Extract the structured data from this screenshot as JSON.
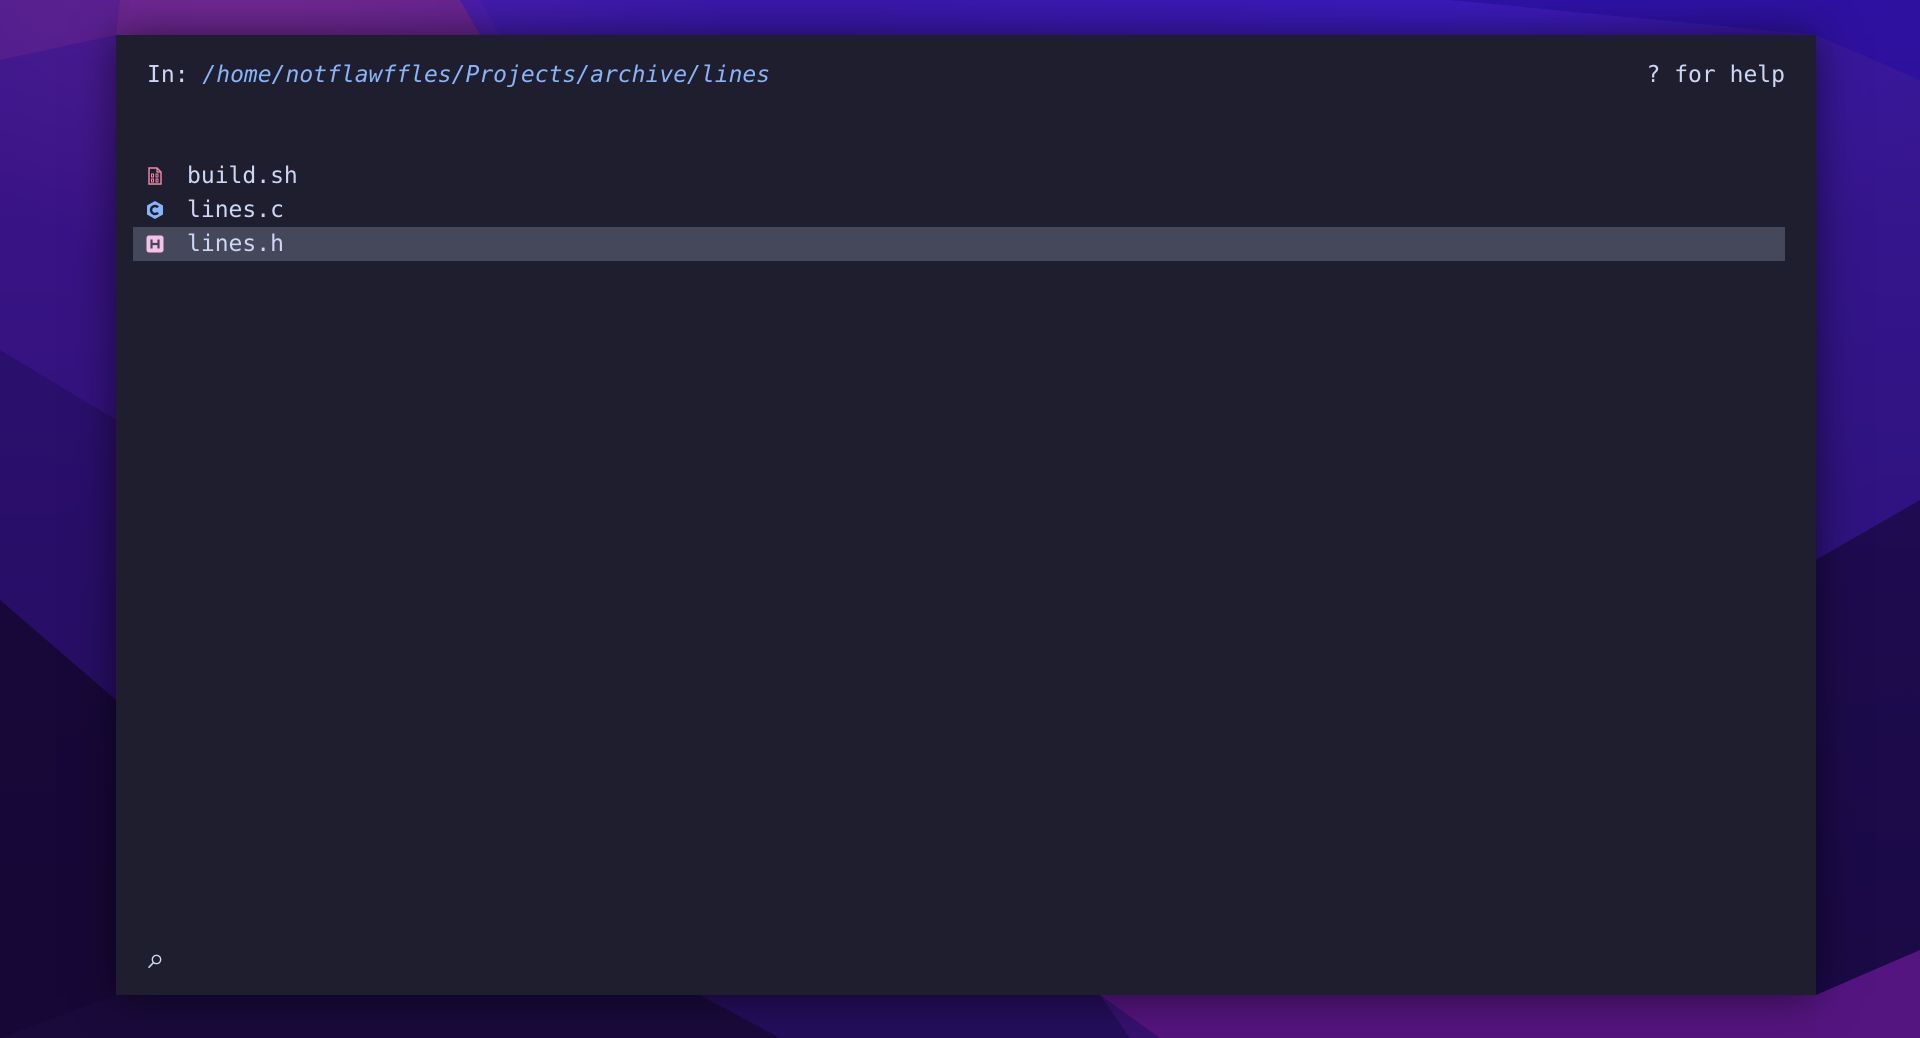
{
  "header": {
    "prefix": "In: ",
    "path": "/home/notflawffles/Projects/archive/lines",
    "help": "? for help"
  },
  "files": [
    {
      "name": "build.sh",
      "icon": "shell-script-icon",
      "color": "#f38ba8",
      "selected": false
    },
    {
      "name": "lines.c",
      "icon": "c-language-icon",
      "color": "#89b4fa",
      "selected": false
    },
    {
      "name": "lines.h",
      "icon": "header-file-icon",
      "color": "#f5c2e7",
      "selected": true
    }
  ],
  "search": {
    "icon": "search-icon"
  },
  "colors": {
    "background": "#1f1e2e",
    "text": "#cdd6f4",
    "path": "#89b4fa",
    "selection": "#45475a"
  }
}
